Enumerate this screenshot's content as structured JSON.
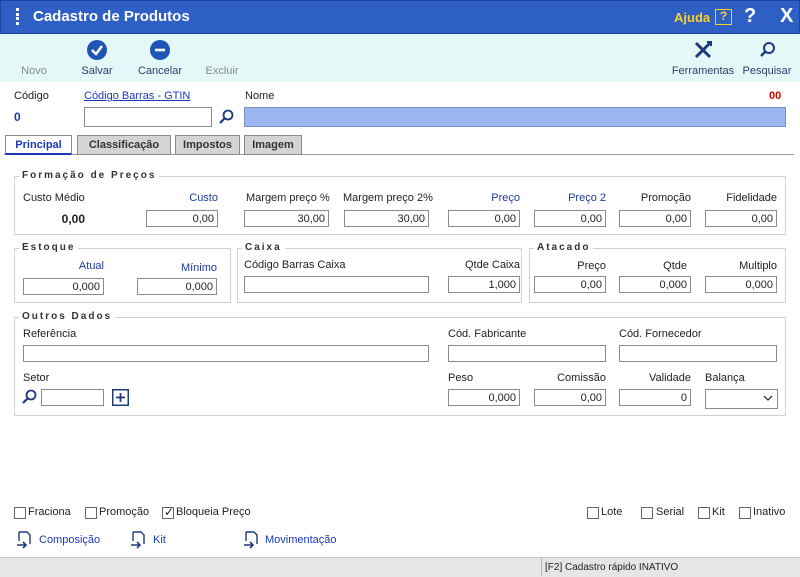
{
  "window": {
    "title": "Cadastro de Produtos",
    "help_label": "Ajuda",
    "help_key": "?",
    "question": "?",
    "close": "X"
  },
  "toolbar": {
    "novo": "Novo",
    "salvar": "Salvar",
    "cancelar": "Cancelar",
    "excluir": "Excluir",
    "ferramentas": "Ferramentas",
    "pesquisar": "Pesquisar"
  },
  "header": {
    "codigo_label": "Código",
    "codigo_value": "0",
    "barcode_link": "Código Barras - GTIN",
    "barcode_value": "",
    "nome_label": "Nome",
    "nome_value": "",
    "nome_counter": "00"
  },
  "tabs": [
    "Principal",
    "Classificação",
    "Impostos",
    "Imagem"
  ],
  "formacao": {
    "title": "Formação de Preços",
    "custo_medio_label": "Custo Médio",
    "custo_medio_value": "0,00",
    "custo_label": "Custo",
    "custo_value": "0,00",
    "margem_label": "Margem preço %",
    "margem_value": "30,00",
    "margem2_label": "Margem preço 2%",
    "margem2_value": "30,00",
    "preco_label": "Preço",
    "preco_value": "0,00",
    "preco2_label": "Preço 2",
    "preco2_value": "0,00",
    "promocao_label": "Promoção",
    "promocao_value": "0,00",
    "fidelidade_label": "Fidelidade",
    "fidelidade_value": "0,00"
  },
  "estoque": {
    "title": "Estoque",
    "atual_label": "Atual",
    "atual_value": "0,000",
    "minimo_label": "Mínimo",
    "minimo_value": "0,000"
  },
  "caixa": {
    "title": "Caixa",
    "codigo_label": "Código Barras Caixa",
    "codigo_value": "",
    "qtde_label": "Qtde Caixa",
    "qtde_value": "1,000"
  },
  "atacado": {
    "title": "Atacado",
    "preco_label": "Preço",
    "preco_value": "0,00",
    "qtde_label": "Qtde",
    "qtde_value": "0,000",
    "multiplo_label": "Multiplo",
    "multiplo_value": "0,000"
  },
  "outros": {
    "title": "Outros Dados",
    "referencia_label": "Referência",
    "referencia_value": "",
    "fabricante_label": "Cód. Fabricante",
    "fabricante_value": "",
    "fornecedor_label": "Cód. Fornecedor",
    "fornecedor_value": "",
    "setor_label": "Setor",
    "setor_value": "",
    "peso_label": "Peso",
    "peso_value": "0,000",
    "comissao_label": "Comissão",
    "comissao_value": "0,00",
    "validade_label": "Validade",
    "validade_value": "0",
    "balanca_label": "Balança",
    "balanca_value": ""
  },
  "checkboxes": {
    "fraciona": "Fraciona",
    "promocao": "Promoção",
    "bloqueia": "Bloqueia Preço",
    "lote": "Lote",
    "serial": "Serial",
    "kit": "Kit",
    "inativo": "Inativo"
  },
  "links": {
    "composicao": "Composição",
    "kit": "Kit",
    "movimentacao": "Movimentação"
  },
  "status": {
    "text": "[F2] Cadastro rápido INATIVO"
  },
  "colors": {
    "titlebar": "#2d5fc4",
    "toolbar": "#e4f8f8",
    "nome_field": "#9bb6f0",
    "accent": "#1e56b5"
  }
}
